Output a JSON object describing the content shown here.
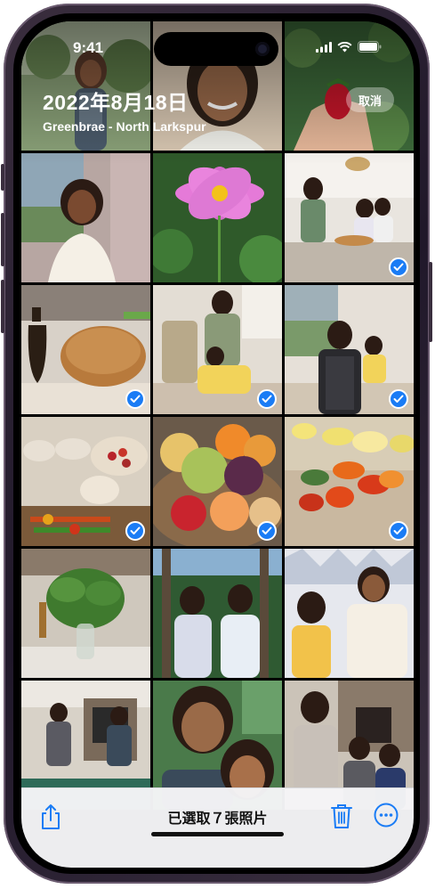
{
  "status_bar": {
    "time": "9:41"
  },
  "header": {
    "date": "2022年8月18日",
    "location": "Greenbrae - North Larkspur",
    "cancel_label": "取消"
  },
  "grid": {
    "tiles": [
      {
        "subject": "woman-in-garden",
        "selected": false
      },
      {
        "subject": "woman-smiling-closeup",
        "selected": false
      },
      {
        "subject": "hand-holding-strawberry",
        "selected": false
      },
      {
        "subject": "woman-portrait-window",
        "selected": false
      },
      {
        "subject": "pink-cosmos-flower",
        "selected": false
      },
      {
        "subject": "family-cooking-kitchen",
        "selected": true
      },
      {
        "subject": "bread-and-olive-oil",
        "selected": true
      },
      {
        "subject": "couple-hugging-kitchen",
        "selected": true
      },
      {
        "subject": "woman-apron-kitchen",
        "selected": true
      },
      {
        "subject": "vegetable-skewers-table",
        "selected": true
      },
      {
        "subject": "fruit-bowl",
        "selected": true
      },
      {
        "subject": "cut-vegetables-board",
        "selected": true
      },
      {
        "subject": "basil-plant-vase",
        "selected": false
      },
      {
        "subject": "two-women-trees",
        "selected": false
      },
      {
        "subject": "girl-and-woman-wall",
        "selected": false
      },
      {
        "subject": "women-high-five-room",
        "selected": false
      },
      {
        "subject": "woman-and-girl-selfie",
        "selected": false
      },
      {
        "subject": "family-by-fireplace",
        "selected": false
      }
    ]
  },
  "toolbar": {
    "title": "已選取７張照片",
    "share_icon": "share-icon",
    "trash_icon": "trash-icon",
    "more_icon": "more-icon"
  },
  "colors": {
    "accent": "#1a7cf5",
    "toolbar_bg": "#f5f5f7"
  }
}
